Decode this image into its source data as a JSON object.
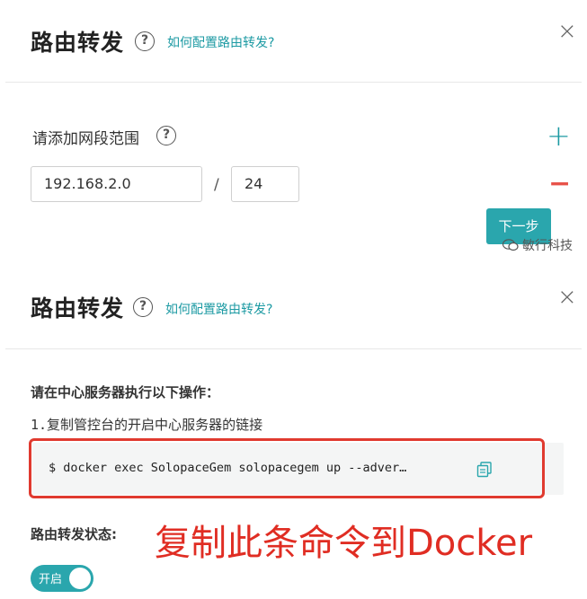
{
  "panel1": {
    "title": "路由转发",
    "help_link": "如何配置路由转发?",
    "close": "×",
    "range_label": "请添加网段范围",
    "ip_value": "192.168.2.0",
    "slash": "/",
    "mask_value": "24",
    "plus": "+",
    "minus": "−",
    "next_button": "下一步",
    "watermark": "敏行科技"
  },
  "panel2": {
    "title": "路由转发",
    "help_link": "如何配置路由转发?",
    "close": "×",
    "instruction_heading": "请在中心服务器执行以下操作：",
    "step1": "1.复制管控台的开启中心服务器的链接",
    "command": "$ docker exec SolopaceGem solopacegem up --adver…",
    "status_label": "路由转发状态:",
    "toggle_label": "开启",
    "toggle_on": true
  },
  "annotation": {
    "text": "复制此条命令到Docker",
    "color": "#e02d23"
  },
  "colors": {
    "accent": "#2aa6ad",
    "link": "#1c9aa3",
    "danger": "#e8534a"
  },
  "help_symbol": "?"
}
